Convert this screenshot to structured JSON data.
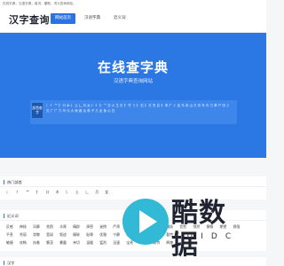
{
  "top_strip": "在线字典，汉语字典，组词，康熙，词义查询网站。",
  "header": {
    "logo": "汉字查询",
    "nav": [
      "网站首页",
      "汉语字典",
      "近义词"
    ]
  },
  "hero": {
    "title": "在线查字典",
    "subtitle": "汉语字典查询网站",
    "radical_tag": "部首查字",
    "radicals": "氵 亻 艹 扌 口 木 讠 土 辶 月 女 忄 纟 钅 宀 日 火 王 贝 阝 竹 刂 犭 石 礻 攵 虫 目 衤 禾 疒 彳 足 马 米 山 又 页 车 巾 力 革 尸 田 彡 欠 厂 广 穴 鸟 弓 大 雨 酉 舌 角 子 几 走 鱼 心 白"
  },
  "sections": {
    "hot_radicals": {
      "title": "热门部首",
      "items": [
        "氵",
        "亻",
        "艹",
        "扌",
        "口",
        "木",
        "讠",
        "土",
        "辶",
        "月",
        "女"
      ]
    },
    "synonyms": {
      "title": "近义词",
      "rows": [
        [
          "反感",
          "神秘",
          "风靡",
          "贫困",
          "丰厚",
          "精辟",
          "周密",
          "迷惘",
          "严肃",
          "持续",
          "安抚",
          "信服",
          "踊跃",
          "忧愁",
          "悄然",
          "慷慨",
          "期望",
          "倔强"
        ],
        [
          "平息",
          "秀丽",
          "崇敬",
          "宽阔",
          "叙述",
          "精致",
          "耻辱",
          "优雅",
          "宁静",
          "诚恳",
          "繁忙",
          "伟大",
          "勤劳"
        ],
        [
          "敏捷",
          "欢畅",
          "执着",
          "繁茂",
          "暴露",
          "亲切",
          "温暖",
          "猛烈",
          "迅速",
          "宝贵",
          "遥远",
          "奇特",
          "辉煌"
        ]
      ]
    },
    "word": {
      "title": "汉字"
    }
  },
  "watermark": {
    "text": "酷数据",
    "sub": "KUIDC"
  }
}
